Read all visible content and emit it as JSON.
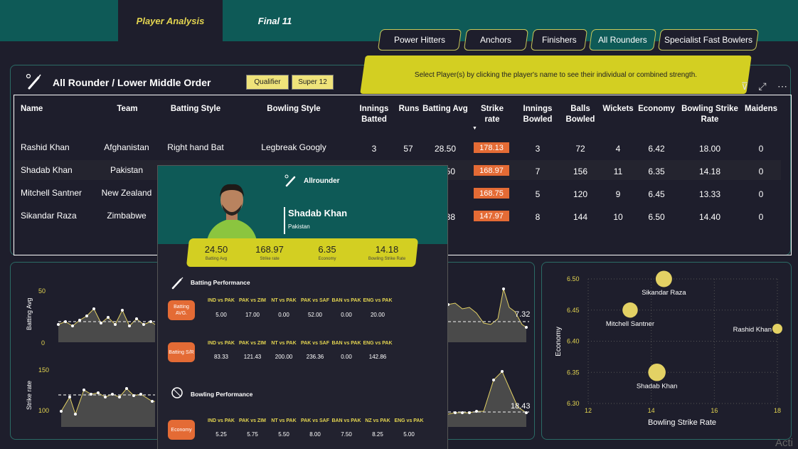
{
  "tabs": [
    {
      "label": "Player Analysis"
    },
    {
      "label": "Final 11"
    }
  ],
  "role_buttons": [
    "Power Hitters",
    "Anchors",
    "Finishers",
    "All Rounders",
    "Specialist Fast Bowlers"
  ],
  "banner": "Select Player(s) by clicking the player's name to see their individual or combined strength.",
  "panel": {
    "title": "All Rounder / Lower Middle Order",
    "filters": [
      "Qualifier",
      "Super 12"
    ]
  },
  "table": {
    "headers": {
      "name": "Name",
      "team": "Team",
      "batting_style": "Batting Style",
      "bowling_style": "Bowling Style",
      "innings_batted": "Innings Batted",
      "runs": "Runs",
      "batting_avg": "Batting Avg",
      "strike_rate": "Strike rate",
      "innings_bowled": "Innings Bowled",
      "balls_bowled": "Balls Bowled",
      "wickets": "Wickets",
      "economy": "Economy",
      "bowling_sr": "Bowling Strike Rate",
      "maidens": "Maidens"
    },
    "rows": [
      {
        "name": "Rashid Khan",
        "team": "Afghanistan",
        "bat": "Right hand Bat",
        "bowl": "Legbreak Googly",
        "ib": "3",
        "runs": "57",
        "avg": "28.50",
        "sr": "178.13",
        "inb": "3",
        "balls": "72",
        "wk": "4",
        "eco": "6.42",
        "bsr": "18.00",
        "md": "0"
      },
      {
        "name": "Shadab Khan",
        "team": "Pakistan",
        "bat": "",
        "bowl": "",
        "ib": "",
        "runs": "",
        "avg": "50",
        "sr": "168.97",
        "inb": "7",
        "balls": "156",
        "wk": "11",
        "eco": "6.35",
        "bsr": "14.18",
        "md": "0"
      },
      {
        "name": "Mitchell Santner",
        "team": "New Zealand",
        "bat": "",
        "bowl": "",
        "ib": "",
        "runs": "",
        "avg": "",
        "sr": "168.75",
        "inb": "5",
        "balls": "120",
        "wk": "9",
        "eco": "6.45",
        "bsr": "13.33",
        "md": "0"
      },
      {
        "name": "Sikandar Raza",
        "team": "Zimbabwe",
        "bat": "",
        "bowl": "",
        "ib": "",
        "runs": "",
        "avg": "38",
        "sr": "147.97",
        "inb": "8",
        "balls": "144",
        "wk": "10",
        "eco": "6.50",
        "bsr": "14.40",
        "md": "0"
      }
    ]
  },
  "card": {
    "role": "Allrounder",
    "player": "Shadab Khan",
    "country": "Pakistan",
    "stats": [
      {
        "value": "24.50",
        "label": "Batting Avg"
      },
      {
        "value": "168.97",
        "label": "Strike rate"
      },
      {
        "value": "6.35",
        "label": "Economy"
      },
      {
        "value": "14.18",
        "label": "Bowling Strike Rate"
      }
    ],
    "batting_title": "Batting Performance",
    "bowling_title": "Bowling Performance",
    "batting_avg_badge": "Batting AVG.",
    "batting_sr_badge": "Batting S/R",
    "economy_badge": "Economy",
    "bat_avg_matches": [
      "IND vs PAK",
      "PAK vs ZIM",
      "NT vs PAK",
      "PAK vs SAF",
      "BAN vs PAK",
      "ENG vs PAK"
    ],
    "bat_avg_values": [
      "5.00",
      "17.00",
      "0.00",
      "52.00",
      "0.00",
      "20.00"
    ],
    "bat_sr_matches": [
      "IND vs PAK",
      "PAK vs ZIM",
      "NT vs PAK",
      "PAK vs SAF",
      "BAN vs PAK",
      "ENG vs PAK"
    ],
    "bat_sr_values": [
      "83.33",
      "121.43",
      "200.00",
      "236.36",
      "0.00",
      "142.86"
    ],
    "eco_matches": [
      "IND vs PAK",
      "PAK vs ZIM",
      "NT vs PAK",
      "PAK vs SAF",
      "BAN vs PAK",
      "NZ vs PAK",
      "ENG vs PAK"
    ],
    "eco_values": [
      "5.25",
      "5.75",
      "5.50",
      "8.00",
      "7.50",
      "8.25",
      "5.00"
    ]
  },
  "line_charts": {
    "top": {
      "ylabel": "Batting Avg",
      "tick_top": "50",
      "tick_bottom": "0",
      "last_label": "7.32"
    },
    "bottom": {
      "ylabel": "Strike rate",
      "tick_top": "150",
      "tick_bottom": "100",
      "last_label": "18.43"
    }
  },
  "chart_data": {
    "type": "scatter",
    "xlabel": "Bowling Strike Rate",
    "ylabel": "Economy",
    "xlim": [
      12,
      18
    ],
    "ylim": [
      6.3,
      6.5
    ],
    "x_ticks": [
      "12",
      "14",
      "16",
      "18"
    ],
    "y_ticks": [
      "6.30",
      "6.35",
      "6.40",
      "6.45",
      "6.50"
    ],
    "points": [
      {
        "label": "Sikandar Raza",
        "x": 14.4,
        "y": 6.5,
        "size": 10
      },
      {
        "label": "Mitchell Santner",
        "x": 13.33,
        "y": 6.45,
        "size": 9
      },
      {
        "label": "Rashid Khan",
        "x": 18.0,
        "y": 6.42,
        "size": 4
      },
      {
        "label": "Shadab Khan",
        "x": 14.18,
        "y": 6.35,
        "size": 11
      }
    ],
    "color": "#e3d164"
  },
  "watermark": "Acti"
}
